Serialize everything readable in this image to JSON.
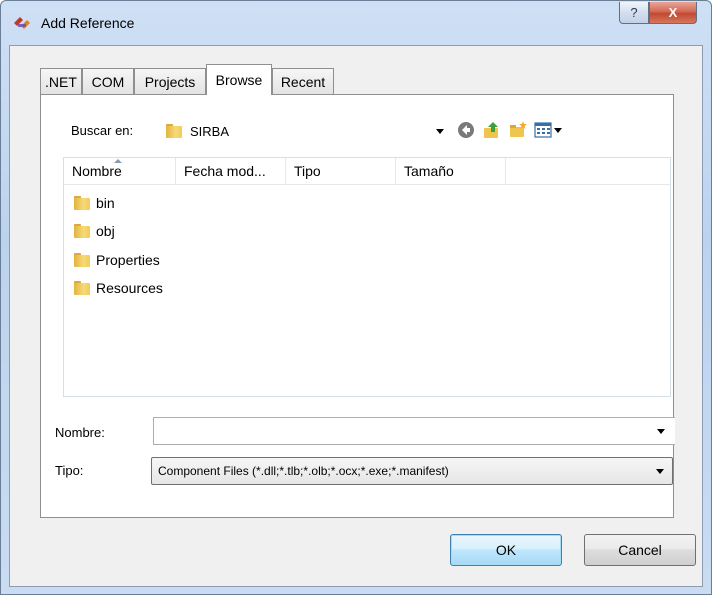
{
  "window": {
    "title": "Add Reference",
    "help_glyph": "?",
    "close_glyph": "X"
  },
  "tabs": [
    {
      "label": ".NET",
      "active": false
    },
    {
      "label": "COM",
      "active": false
    },
    {
      "label": "Projects",
      "active": false
    },
    {
      "label": "Browse",
      "active": true
    },
    {
      "label": "Recent",
      "active": false
    }
  ],
  "lookin": {
    "label": "Buscar en:",
    "value": "SIRBA"
  },
  "toolbar": {
    "back_icon": "back-arrow-icon",
    "up_icon": "up-one-level-icon",
    "newfolder_icon": "new-folder-icon",
    "views_icon": "views-menu-icon"
  },
  "filelist": {
    "columns": [
      "Nombre",
      "Fecha mod...",
      "Tipo",
      "Tamaño"
    ],
    "items": [
      "bin",
      "obj",
      "Properties",
      "Resources"
    ]
  },
  "filename": {
    "label": "Nombre:",
    "value": ""
  },
  "filetype": {
    "label": "Tipo:",
    "value": "Component Files (*.dll;*.tlb;*.olb;*.ocx;*.exe;*.manifest)"
  },
  "buttons": {
    "ok": "OK",
    "cancel": "Cancel"
  },
  "colors": {
    "accent": "#3c7fb1",
    "close": "#c04a32",
    "folder": "#e2b43e"
  }
}
